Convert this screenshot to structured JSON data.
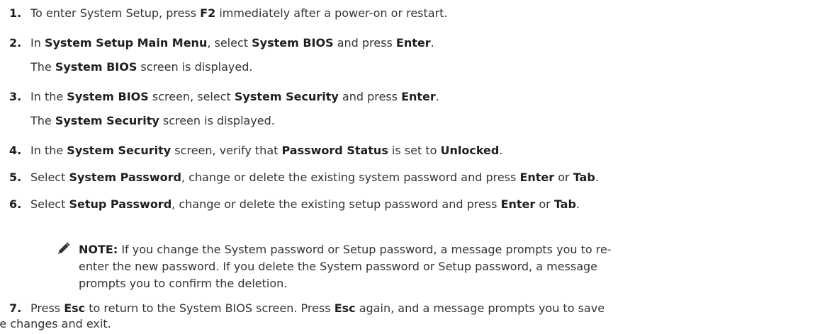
{
  "steps": [
    {
      "num": "1.",
      "parts": [
        {
          "t": "To enter System Setup, press ",
          "b": false
        },
        {
          "t": "F2",
          "b": true
        },
        {
          "t": " immediately after a power-on or restart.",
          "b": false
        }
      ]
    },
    {
      "num": "2.",
      "parts": [
        {
          "t": "In ",
          "b": false
        },
        {
          "t": "System Setup Main Menu",
          "b": true
        },
        {
          "t": ", select ",
          "b": false
        },
        {
          "t": "System BIOS",
          "b": true
        },
        {
          "t": " and press ",
          "b": false
        },
        {
          "t": "Enter",
          "b": true
        },
        {
          "t": ".",
          "b": false
        }
      ]
    },
    {
      "num": "",
      "parts": [
        {
          "t": "The ",
          "b": false
        },
        {
          "t": "System BIOS",
          "b": true
        },
        {
          "t": " screen is displayed.",
          "b": false
        }
      ]
    },
    {
      "num": "3.",
      "parts": [
        {
          "t": "In the ",
          "b": false
        },
        {
          "t": "System BIOS",
          "b": true
        },
        {
          "t": " screen, select ",
          "b": false
        },
        {
          "t": "System Security",
          "b": true
        },
        {
          "t": " and press ",
          "b": false
        },
        {
          "t": "Enter",
          "b": true
        },
        {
          "t": ".",
          "b": false
        }
      ]
    },
    {
      "num": "",
      "parts": [
        {
          "t": "The ",
          "b": false
        },
        {
          "t": "System Security",
          "b": true
        },
        {
          "t": " screen is displayed.",
          "b": false
        }
      ]
    },
    {
      "num": "4.",
      "parts": [
        {
          "t": "In the ",
          "b": false
        },
        {
          "t": "System Security",
          "b": true
        },
        {
          "t": " screen, verify that ",
          "b": false
        },
        {
          "t": "Password Status",
          "b": true
        },
        {
          "t": " is set to ",
          "b": false
        },
        {
          "t": "Unlocked",
          "b": true
        },
        {
          "t": ".",
          "b": false
        }
      ]
    },
    {
      "num": "5.",
      "parts": [
        {
          "t": "Select ",
          "b": false
        },
        {
          "t": "System Password",
          "b": true
        },
        {
          "t": ", change or delete the existing system password and press ",
          "b": false
        },
        {
          "t": "Enter",
          "b": true
        },
        {
          "t": " or ",
          "b": false
        },
        {
          "t": "Tab",
          "b": true
        },
        {
          "t": ".",
          "b": false
        }
      ]
    },
    {
      "num": "6.",
      "parts": [
        {
          "t": "Select ",
          "b": false
        },
        {
          "t": "Setup Password",
          "b": true
        },
        {
          "t": ", change or delete the existing setup password and press ",
          "b": false
        },
        {
          "t": "Enter",
          "b": true
        },
        {
          "t": " or ",
          "b": false
        },
        {
          "t": "Tab",
          "b": true
        },
        {
          "t": ".",
          "b": false
        }
      ]
    }
  ],
  "note": {
    "icon": "pencil-note-icon",
    "label": "NOTE:",
    "lines": [
      "If you change the System password or Setup password, a message prompts you to re-",
      "enter the new password. If you delete the System password or Setup password, a message",
      "prompts you to confirm the deletion."
    ]
  },
  "step7": {
    "num": "7.",
    "line1_parts": [
      {
        "t": "Press ",
        "b": false
      },
      {
        "t": "Esc",
        "b": true
      },
      {
        "t": " to return to the System BIOS screen. Press ",
        "b": false
      },
      {
        "t": "Esc",
        "b": true
      },
      {
        "t": " again, and a message prompts you to save",
        "b": false
      }
    ],
    "line2": "the changes and exit."
  }
}
